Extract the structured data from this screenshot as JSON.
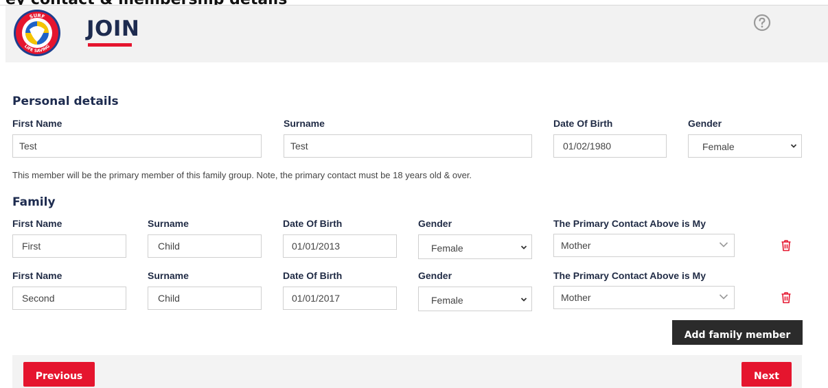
{
  "page": {
    "clipped_heading": "ey contact & membership details"
  },
  "header": {
    "logo_text_top": "SURF",
    "logo_text_bottom": "LIFE SAVING",
    "title": "JOIN",
    "help_icon": "question-circle-icon",
    "accent_color": "#e5152e",
    "title_color": "#1d2b4f"
  },
  "personal": {
    "heading": "Personal details",
    "first_name_label": "First Name",
    "first_name_value": "Test",
    "surname_label": "Surname",
    "surname_value": "Test",
    "dob_label": "Date Of Birth",
    "dob_value": "01/02/1980",
    "gender_label": "Gender",
    "gender_value": "Female",
    "note": "This member will be the primary member of this family group. Note, the primary contact must be 18 years old & over."
  },
  "family": {
    "heading": "Family",
    "members": [
      {
        "first_name_label": "First Name",
        "first_name": "First",
        "surname_label": "Surname",
        "surname": "Child",
        "dob_label": "Date Of Birth",
        "dob": "01/01/2013",
        "gender_label": "Gender",
        "gender": "Female",
        "relation_label": "The Primary Contact Above is My",
        "relation": "Mother"
      },
      {
        "first_name_label": "First Name",
        "first_name": "Second",
        "surname_label": "Surname",
        "surname": "Child",
        "dob_label": "Date Of Birth",
        "dob": "01/01/2017",
        "gender_label": "Gender",
        "gender": "Female",
        "relation_label": "The Primary Contact Above is My",
        "relation": "Mother"
      }
    ],
    "delete_icon": "trash-icon",
    "add_button": "Add family member"
  },
  "nav": {
    "previous": "Previous",
    "next": "Next"
  }
}
